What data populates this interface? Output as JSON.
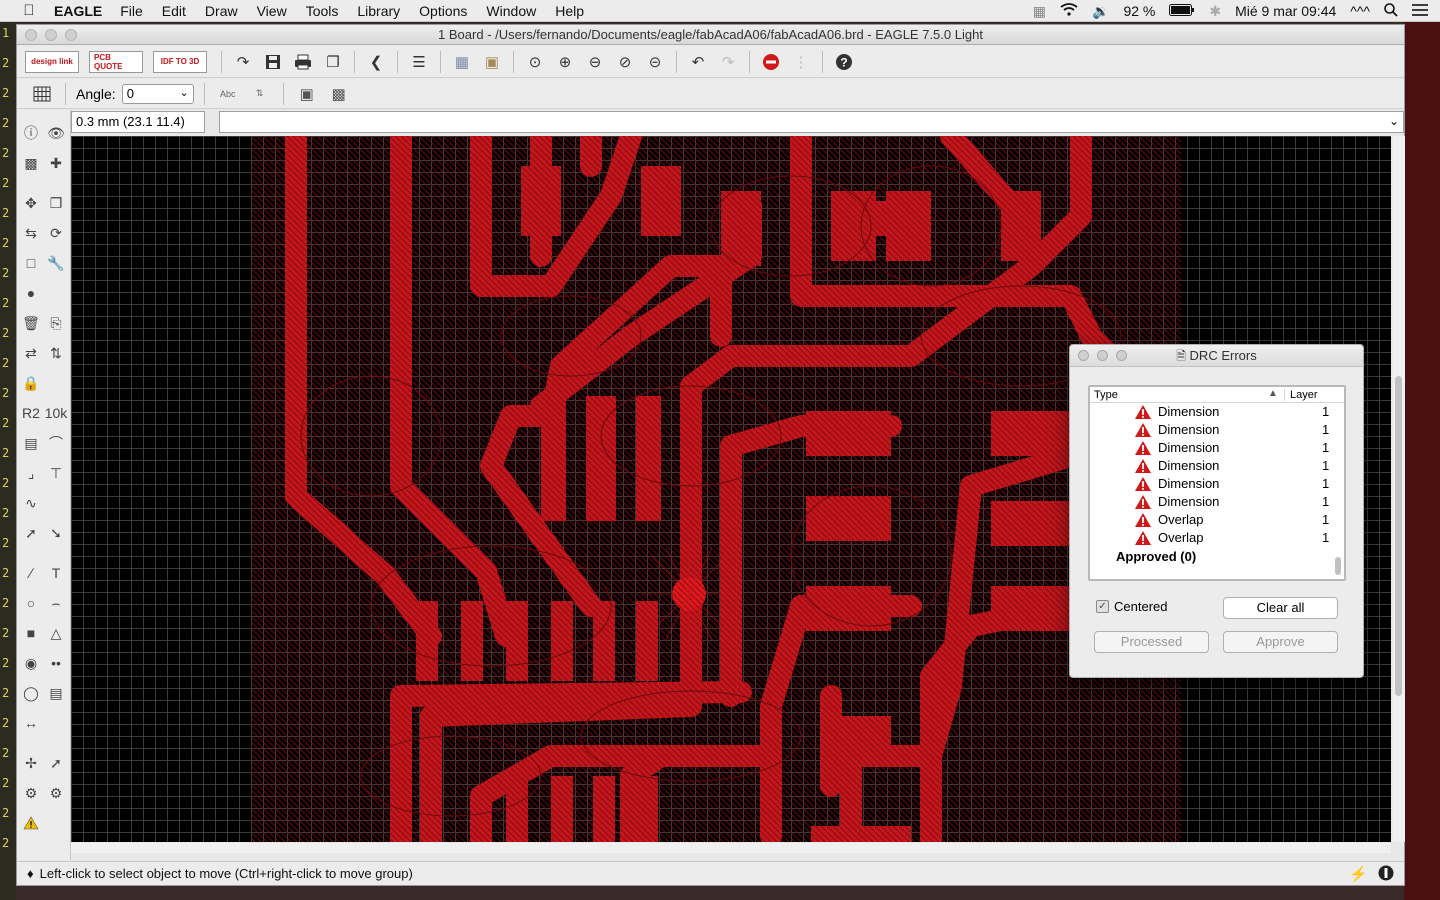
{
  "menubar": {
    "app": "EAGLE",
    "items": [
      "File",
      "Edit",
      "Draw",
      "View",
      "Tools",
      "Library",
      "Options",
      "Window",
      "Help"
    ],
    "battery": "92 %",
    "datetime": "Mié 9 mar  09:44",
    "extra": "^^^"
  },
  "left_strip": {
    "lines": [
      "1",
      "2",
      "2",
      "2",
      "2",
      "2",
      "2",
      "2",
      "2",
      "2",
      "2",
      "2",
      "2",
      "2",
      "2",
      "2",
      "2",
      "2",
      "2",
      "2",
      "2",
      "2",
      "2",
      "2",
      "2",
      "2",
      "2",
      "2"
    ]
  },
  "window": {
    "title": "1 Board - /Users/fernando/Documents/eagle/fabAcadA06/fabAcadA06.brd - EAGLE 7.5.0 Light"
  },
  "toolbar": {
    "brand_buttons": [
      "design link",
      "PCB QUOTE",
      "IDF TO 3D"
    ]
  },
  "toolbar2": {
    "angle_label": "Angle:",
    "angle_value": "0"
  },
  "cmd": {
    "coordinates": "0.3 mm (23.1 11.4)",
    "command_value": ""
  },
  "status": {
    "message": "Left-click to select object to move (Ctrl+right-click to move group)"
  },
  "drc": {
    "title": "DRC Errors",
    "col_type": "Type",
    "col_layer": "Layer",
    "errors": [
      {
        "type": "Dimension",
        "layer": "1"
      },
      {
        "type": "Dimension",
        "layer": "1"
      },
      {
        "type": "Dimension",
        "layer": "1"
      },
      {
        "type": "Dimension",
        "layer": "1"
      },
      {
        "type": "Dimension",
        "layer": "1"
      },
      {
        "type": "Dimension",
        "layer": "1"
      },
      {
        "type": "Overlap",
        "layer": "1"
      },
      {
        "type": "Overlap",
        "layer": "1"
      }
    ],
    "approved": "Approved (0)",
    "centered_label": "Centered",
    "centered_checked": true,
    "clear_all": "Clear all",
    "processed": "Processed",
    "approve": "Approve"
  },
  "colors": {
    "copper": "#c4161c",
    "canvas_bg": "#000000",
    "warning": "#d01818"
  }
}
